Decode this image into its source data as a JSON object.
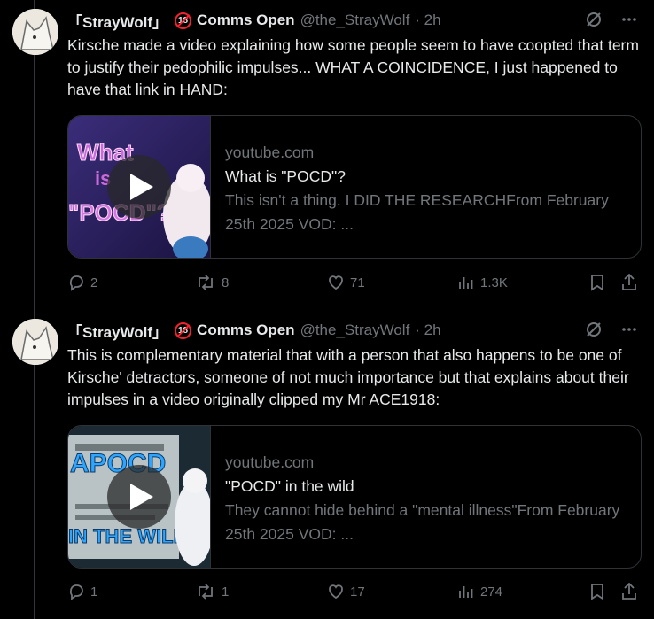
{
  "tweets": [
    {
      "display_name": "「StrayWolf」",
      "badge": "18",
      "name_suffix": "Comms Open",
      "handle": "@the_StrayWolf",
      "time": "· 2h",
      "text": "Kirsche made a video explaining how some people seem to have coopted that term to justify their pedophilic impulses... WHAT A COINCIDENCE, I just happened to have that link in HAND:",
      "card": {
        "domain": "youtube.com",
        "title": "What is \"POCD\"?",
        "description": "This isn't a thing. I DID THE RESEARCHFrom February 25th 2025 VOD: ...",
        "thumb_text": "What is \"POCD\"?"
      },
      "replies": "2",
      "reposts": "8",
      "likes": "71",
      "views": "1.3K"
    },
    {
      "display_name": "「StrayWolf」",
      "badge": "18",
      "name_suffix": "Comms Open",
      "handle": "@the_StrayWolf",
      "time": "· 2h",
      "text": "This is complementary material that with a person that also happens to be one of Kirsche' detractors, someone of not much importance but that explains about their impulses in a video originally clipped my Mr ACE1918:",
      "card": {
        "domain": "youtube.com",
        "title": "\"POCD\" in the wild",
        "description": "They cannot hide behind a \"mental illness\"From February 25th 2025 VOD: ...",
        "thumb_text": "A POCD IN THE WILD"
      },
      "replies": "1",
      "reposts": "1",
      "likes": "17",
      "views": "274"
    }
  ],
  "colors": {
    "bg": "#000000",
    "text": "#e7e9ea",
    "muted": "#71767b",
    "border": "#2f3336",
    "badge": "#f4212e"
  }
}
